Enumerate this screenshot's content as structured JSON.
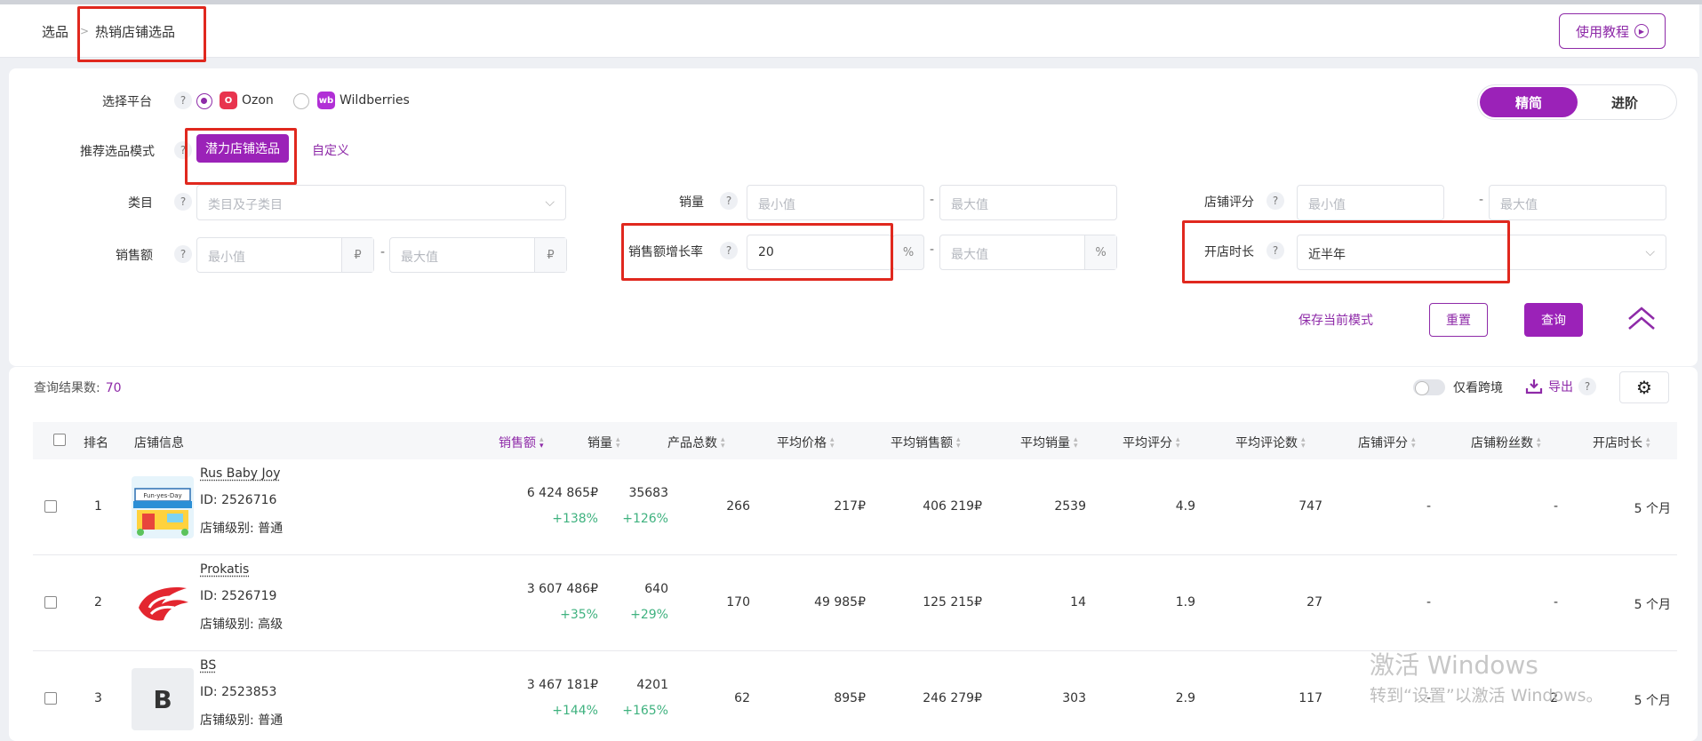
{
  "breadcrumb": {
    "first": "选品",
    "separator": ">",
    "current": "热销店铺选品"
  },
  "header": {
    "tutorial_label": "使用教程"
  },
  "filters": {
    "platform_label": "选择平台",
    "platforms": [
      {
        "name": "Ozon",
        "selected": true,
        "logo_color": "#e8344e"
      },
      {
        "name": "Wildberries",
        "selected": false,
        "logo_color": "#b12fd6"
      }
    ],
    "view_toggle": {
      "simple": "精简",
      "advanced": "进阶"
    },
    "mode_label": "推荐选品模式",
    "mode_active": "潜力店铺选品",
    "mode_custom": "自定义",
    "category": {
      "label": "类目",
      "placeholder": "类目及子类目"
    },
    "sales": {
      "label": "销量",
      "min_placeholder": "最小值",
      "max_placeholder": "最大值"
    },
    "shop_rating": {
      "label": "店铺评分",
      "min_placeholder": "最小值",
      "max_placeholder": "最大值"
    },
    "revenue": {
      "label": "销售额",
      "min_placeholder": "最小值",
      "max_placeholder": "最大值",
      "unit": "₽"
    },
    "revenue_growth": {
      "label": "销售额增长率",
      "min_value": "20",
      "max_placeholder": "最大值",
      "unit": "%"
    },
    "shop_age": {
      "label": "开店时长",
      "value": "近半年"
    },
    "dash": "-",
    "help": "?",
    "save_mode": "保存当前模式",
    "reset": "重置",
    "query": "查询"
  },
  "results": {
    "count_label": "查询结果数:",
    "count_value": "70",
    "cross_border_only": "仅看跨境",
    "export_label": "导出",
    "columns": [
      "排名",
      "店铺信息",
      "销售额",
      "销量",
      "产品总数",
      "平均价格",
      "平均销售额",
      "平均销量",
      "平均评分",
      "平均评论数",
      "店铺评分",
      "店铺粉丝数",
      "开店时长"
    ],
    "rows": [
      {
        "rank": "1",
        "name": "Rus Baby Joy",
        "id": "ID: 2526716",
        "level": "店铺级别: 普通",
        "revenue": "6 424 865₽",
        "revenue_growth": "+138%",
        "sales": "35683",
        "sales_growth": "+126%",
        "products": "266",
        "avg_price": "217₽",
        "avg_revenue": "406 219₽",
        "avg_sales": "2539",
        "avg_rating": "4.9",
        "avg_reviews": "747",
        "shop_rating": "-",
        "fans": "-",
        "age": "5 个月",
        "logo": "shop",
        "logo_text": "Fun-yes-Day"
      },
      {
        "rank": "2",
        "name": "Prokatis",
        "id": "ID: 2526719",
        "level": "店铺级别: 高级",
        "revenue": "3 607 486₽",
        "revenue_growth": "+35%",
        "sales": "640",
        "sales_growth": "+29%",
        "products": "170",
        "avg_price": "49 985₽",
        "avg_revenue": "125 215₽",
        "avg_sales": "14",
        "avg_rating": "1.9",
        "avg_reviews": "27",
        "shop_rating": "-",
        "fans": "-",
        "age": "5 个月",
        "logo": "wing"
      },
      {
        "rank": "3",
        "name": "BS",
        "id": "ID: 2523853",
        "level": "店铺级别: 普通",
        "revenue": "3 467 181₽",
        "revenue_growth": "+144%",
        "sales": "4201",
        "sales_growth": "+165%",
        "products": "62",
        "avg_price": "895₽",
        "avg_revenue": "246 279₽",
        "avg_sales": "303",
        "avg_rating": "2.9",
        "avg_reviews": "117",
        "shop_rating": "-",
        "fans": "2",
        "age": "5 个月",
        "logo": "letter",
        "logo_letter": "B"
      }
    ]
  },
  "watermark": {
    "line1": "激活 Windows",
    "line2": "转到“设置”以激活 Windows。"
  },
  "colors": {
    "accent": "#9b22b8",
    "growth": "#3fb27f",
    "highlight": "#e0281e"
  }
}
